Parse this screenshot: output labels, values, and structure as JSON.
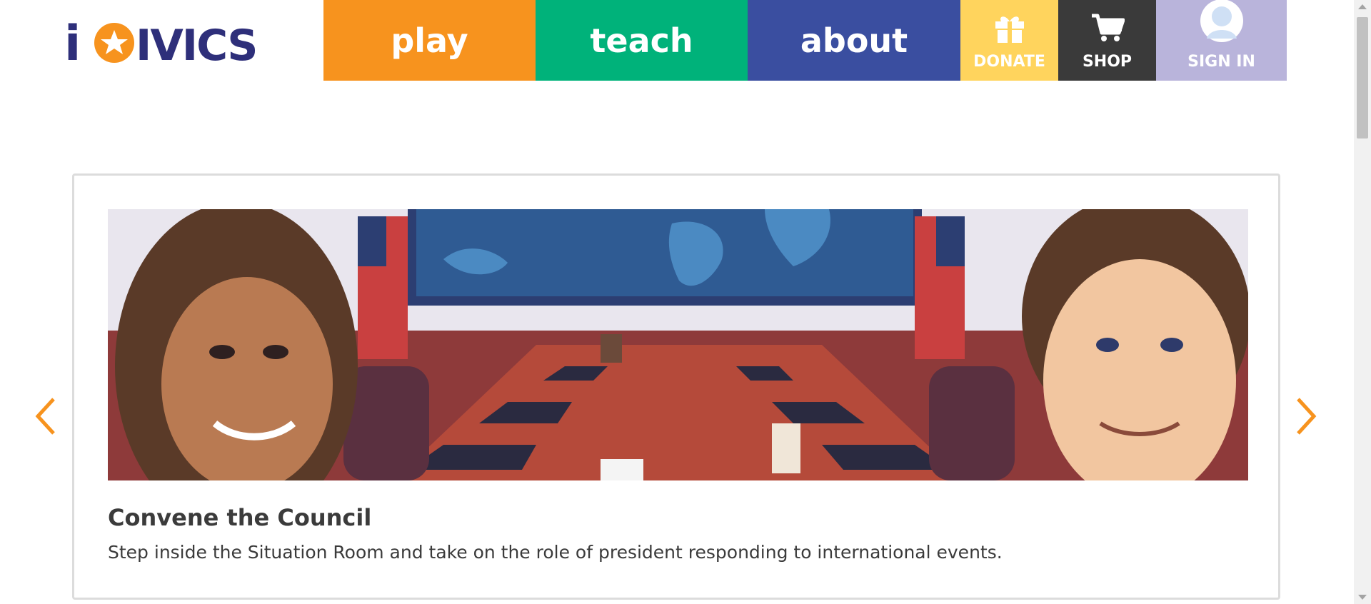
{
  "brand": {
    "name": "iCivics",
    "logo_text": "iCIVICS"
  },
  "nav": {
    "play": "play",
    "teach": "teach",
    "about": "about",
    "donate": "DONATE",
    "shop": "SHOP",
    "sign_in": "SIGN IN"
  },
  "colors": {
    "play": "#f7931e",
    "teach": "#00b27a",
    "about": "#3a4ea0",
    "donate": "#ffd45d",
    "shop": "#3a3a3a",
    "sign_in": "#b9b4db",
    "logo": "#2e2f7a",
    "logo_accent": "#f7931e"
  },
  "icons": {
    "donate": "gift-icon",
    "shop": "cart-icon",
    "sign_in": "user-avatar-icon",
    "prev": "chevron-left-icon",
    "next": "chevron-right-icon"
  },
  "carousel": {
    "slide": {
      "title": "Convene the Council",
      "description": "Step inside the Situation Room and take on the role of president responding to international events."
    }
  }
}
